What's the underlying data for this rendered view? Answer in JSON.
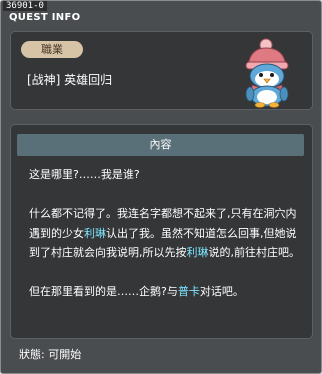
{
  "window": {
    "quest_id": "36901-0",
    "title": "QUEST INFO"
  },
  "job": {
    "badge": "職業",
    "name": "[战神] 英雄回归"
  },
  "content": {
    "header": "內容",
    "p1": "这是哪里?……我是谁?",
    "p2_a": "什么都不记得了。我连名字都想不起来了,只有在洞穴内遇到的少女",
    "p2_name1": "利琳",
    "p2_b": "认出了我。虽然不知道怎么回事,但她说到了村庄就会向我说明,所以先按",
    "p2_name2": "利琳",
    "p2_c": "说的,前往村庄吧。",
    "p3_a": "但在那里看到的是……企鹅?与",
    "p3_name": "普卡",
    "p3_b": "对话吧。"
  },
  "status": {
    "text": "狀態: 可開始"
  },
  "npc": {
    "icon": "penguin-npc-icon",
    "hat_color": "#e07a82",
    "body_color": "#5fa8d8"
  }
}
